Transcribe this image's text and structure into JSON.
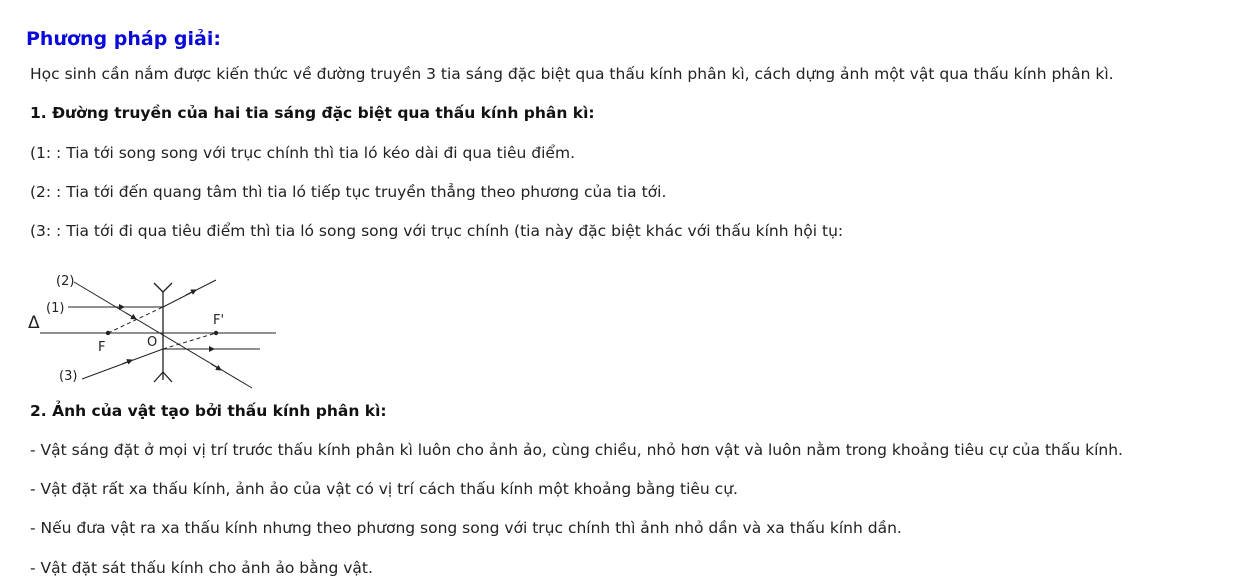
{
  "heading": "Phương pháp giải:",
  "intro": "Học sinh cần nắm được kiến thức về đường truyền 3 tia sáng đặc biệt qua thấu kính phân kì, cách dựng ảnh một vật qua thấu kính phân kì.",
  "section1": {
    "title": "1. Đường truyền của hai tia sáng đặc biệt qua thấu kính phân kì:",
    "rays": [
      "(1: : Tia tới song song với trục chính thì tia ló kéo dài đi qua tiêu điểm.",
      "(2: : Tia tới đến quang tâm thì tia ló tiếp tục truyền thẳng theo phương của tia tới.",
      "(3: : Tia tới đi qua tiêu điểm thì tia ló song song với trục chính (tia này đặc biệt khác với thấu kính hội tụ:"
    ]
  },
  "diagram": {
    "labels": {
      "ray2": "(2)",
      "ray1": "(1)",
      "ray3": "(3)",
      "axis": "Δ",
      "focus": "F",
      "focus_prime": "F'",
      "center": "O"
    }
  },
  "section2": {
    "title": "2. Ảnh của vật tạo bởi thấu kính phân kì:",
    "points": [
      "- Vật sáng đặt ở mọi vị trí trước thấu kính phân kì luôn cho ảnh ảo, cùng chiều, nhỏ hơn vật và luôn nằm trong khoảng tiêu cự của thấu kính.",
      "- Vật đặt rất xa thấu kính, ảnh ảo của vật có vị trí cách thấu kính một khoảng bằng tiêu cự.",
      "- Nếu đưa vật ra xa thấu kính nhưng theo phương song song với trục chính thì ảnh nhỏ dần và xa thấu kính dần.",
      "- Vật đặt sát thấu kính cho ảnh ảo bằng vật."
    ]
  }
}
